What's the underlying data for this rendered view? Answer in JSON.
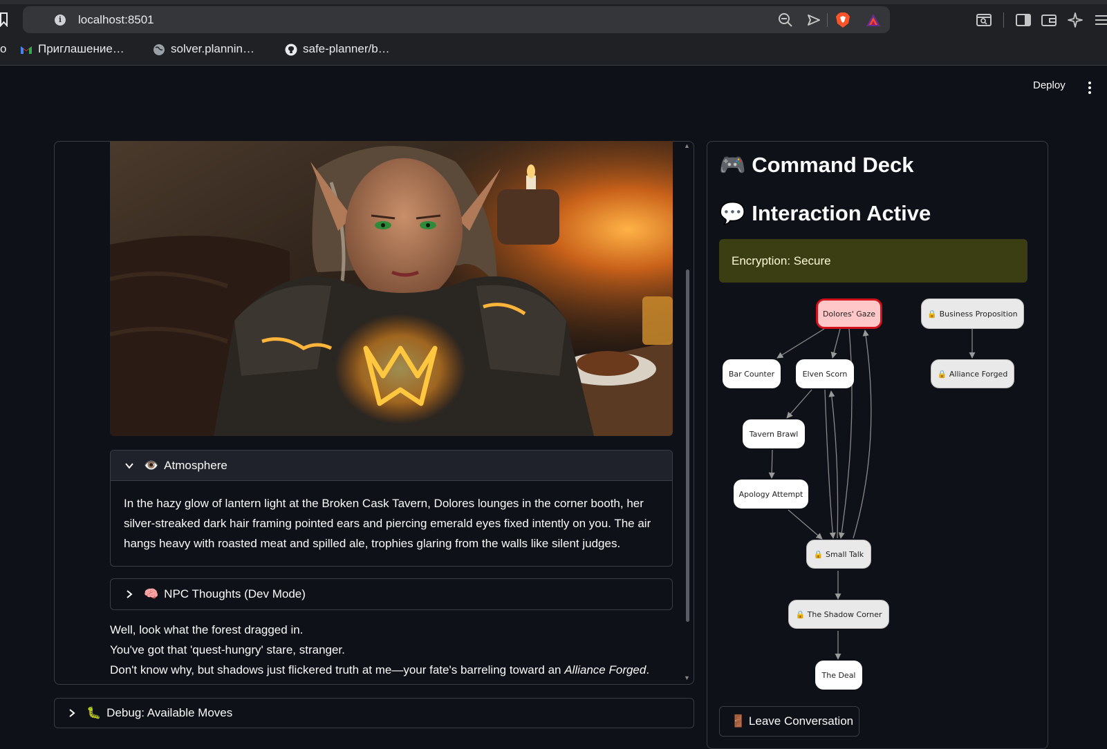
{
  "browser": {
    "url": "localhost:8501",
    "bookmarks": [
      "Приглашение…",
      "solver.plannin…",
      "safe-planner/b…"
    ],
    "left_fragment": "о"
  },
  "header": {
    "deploy_label": "Deploy"
  },
  "scene": {
    "atmosphere_title": "Atmosphere",
    "atmosphere_emoji": "👁️",
    "atmosphere_text": "In the hazy glow of lantern light at the Broken Cask Tavern, Dolores lounges in the corner booth, her silver-streaked dark hair framing pointed ears and piercing emerald eyes fixed intently on you. The air hangs heavy with roasted meat and spilled ale, trophies glaring from the walls like silent judges.",
    "thoughts_title": "NPC Thoughts (Dev Mode)",
    "thoughts_emoji": "🧠",
    "dialog_lines": [
      "Well, look what the forest dragged in.",
      "You've got that 'quest-hungry' stare, stranger.",
      "Don't know why, but shadows just flickered truth at me—your fate's barreling toward an "
    ],
    "dialog_emphasis": "Alliance Forged",
    "dialog_end": ".",
    "debug_title": "Debug: Available Moves",
    "debug_emoji": "🐛"
  },
  "deck": {
    "title": "Command Deck",
    "title_emoji": "🎮",
    "subtitle": "Interaction Active",
    "subtitle_emoji": "💬",
    "status": "Encryption: Secure",
    "leave_label": "Leave Conversation",
    "leave_emoji": "🚪"
  },
  "graph": {
    "nodes": {
      "gaze": "Dolores' Gaze",
      "business": "🔒 Business Proposition",
      "bar": "Bar Counter",
      "scorn": "Elven Scorn",
      "alliance": "🔒 Alliance Forged",
      "brawl": "Tavern Brawl",
      "apology": "Apology Attempt",
      "smalltalk": "🔒 Small Talk",
      "shadow": "🔒 The Shadow Corner",
      "deal": "The Deal"
    }
  },
  "colors": {
    "background": "#0e1117",
    "active_node_fill": "#ffc7c7",
    "active_node_border": "#d1111b",
    "status_bg": "#3b3d12",
    "status_text": "#fdfdd8"
  }
}
